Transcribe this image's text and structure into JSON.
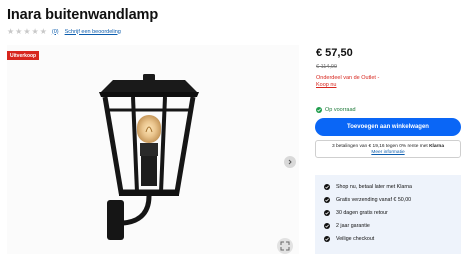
{
  "product": {
    "title": "Inara buitenwandlamp",
    "rating_count": "(0)",
    "review_link": "Schrijf een beoordeling",
    "sale_badge": "Uitverkoop"
  },
  "pricing": {
    "price": "€ 57,50",
    "old_price": "€ 114,99",
    "outlet_text": "Onderdeel van de Outlet -",
    "outlet_link": "Koop nu"
  },
  "availability": {
    "status": "Op voorraad"
  },
  "cart": {
    "add_label": "Toevoegen aan winkelwagen"
  },
  "klarna": {
    "text": "3 betalingen van € 19,16 tegen 0% rente met",
    "brand": "Klarna",
    "more": "Meer informatie"
  },
  "usps": [
    "Shop nu, betaal later met Klarna",
    "Gratis verzending vanaf € 50,00",
    "30 dagen gratis retour",
    "2 jaar garantie",
    "Veilige checkout"
  ],
  "colors": {
    "accent": "#0a66f6",
    "sale": "#d7261e",
    "stock": "#1f9d4c",
    "usp_bg": "#eef3fb"
  },
  "icons": [
    "star-icon",
    "chevron-right-icon",
    "zoom-icon",
    "check-icon"
  ]
}
